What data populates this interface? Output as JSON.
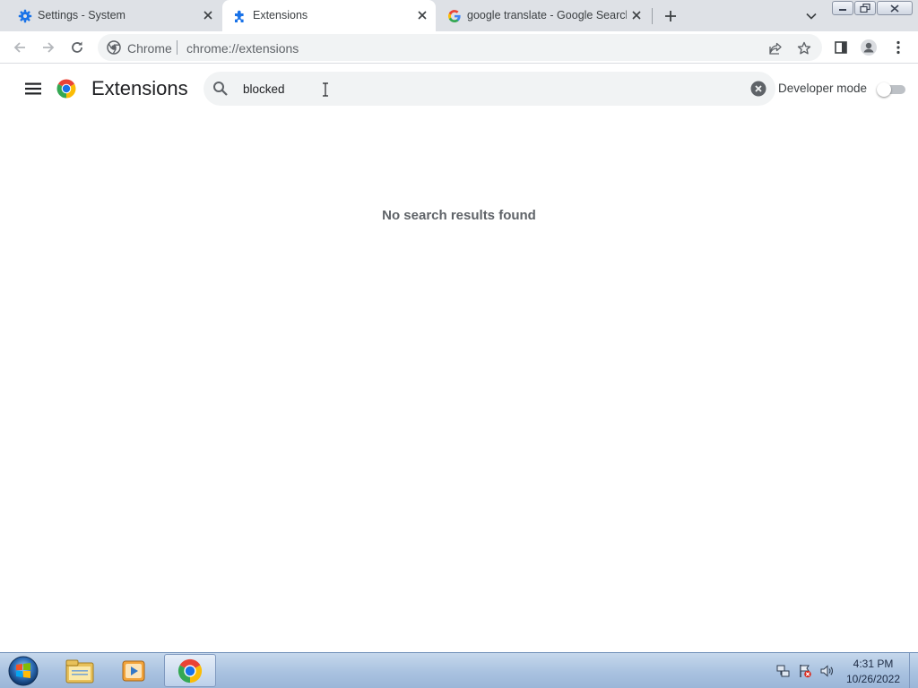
{
  "browser": {
    "tabs": [
      {
        "title": "Settings - System",
        "icon": "gear-icon",
        "active": false
      },
      {
        "title": "Extensions",
        "icon": "puzzle-icon",
        "active": true
      },
      {
        "title": "google translate - Google Search",
        "icon": "google-icon",
        "active": false
      }
    ],
    "omnibox": {
      "site_label": "Chrome",
      "url": "chrome://extensions"
    }
  },
  "extensions_page": {
    "title": "Extensions",
    "search_value": "blocked",
    "developer_mode_label": "Developer mode",
    "developer_mode_enabled": false,
    "empty_message": "No search results found"
  },
  "taskbar": {
    "apps": [
      "windows-explorer-icon",
      "media-player-icon",
      "chrome-icon"
    ],
    "active_app": "chrome-icon",
    "time": "4:31 PM",
    "date": "10/26/2022"
  },
  "colors": {
    "tab_strip": "#dee1e6",
    "accent_blue": "#1a73e8",
    "omnibox_bg": "#f1f3f4",
    "text_secondary": "#5f6368"
  }
}
